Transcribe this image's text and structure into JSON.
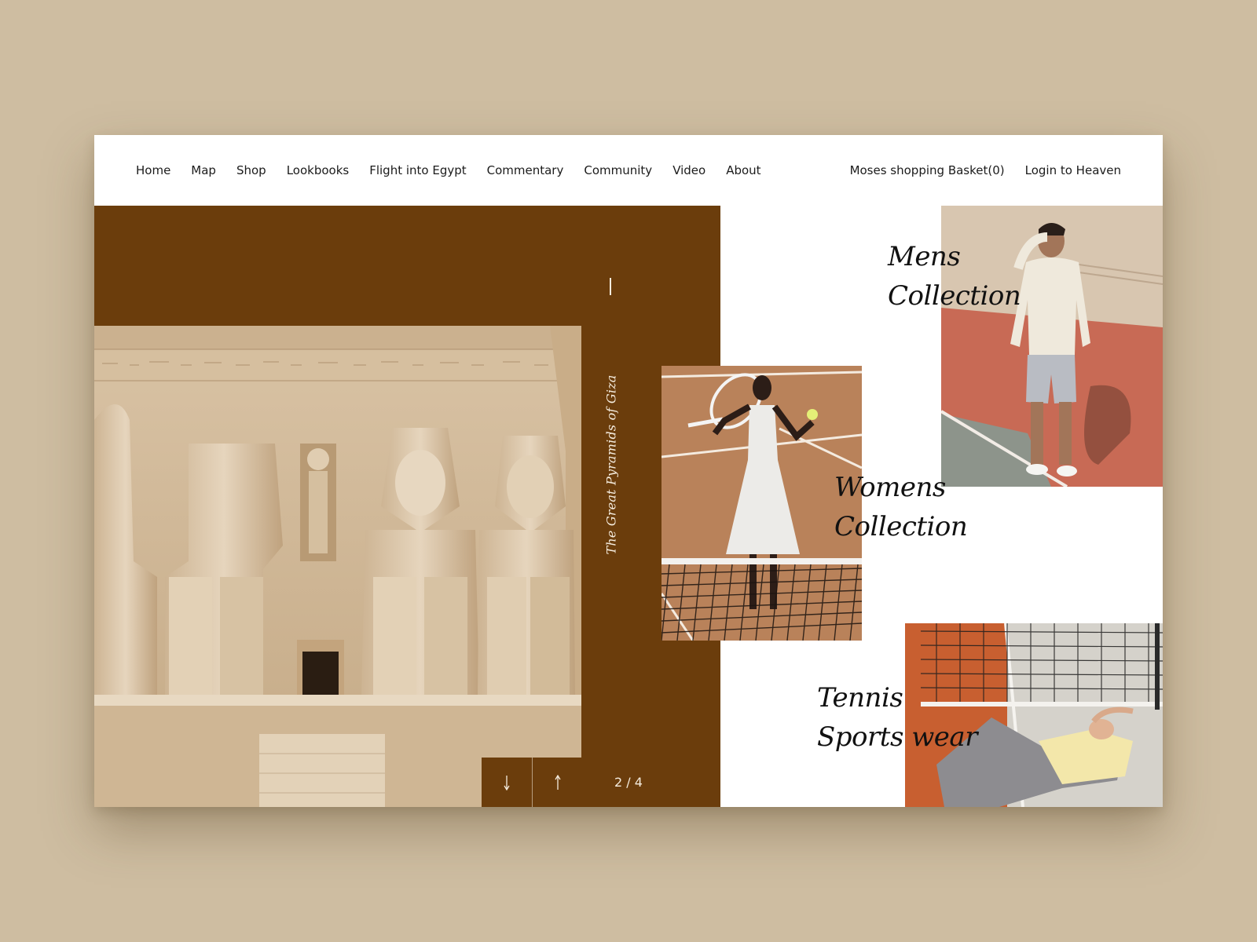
{
  "nav": {
    "left": [
      {
        "label": "Home"
      },
      {
        "label": "Map"
      },
      {
        "label": "Shop"
      },
      {
        "label": "Lookbooks"
      },
      {
        "label": "Flight into Egypt"
      },
      {
        "label": "Commentary"
      },
      {
        "label": "Community"
      },
      {
        "label": "Video"
      },
      {
        "label": "About"
      }
    ],
    "basket": "Moses shopping Basket(0)",
    "login": "Login to Heaven"
  },
  "hero": {
    "caption": "The Great Pyramids of Giza",
    "pager": {
      "down_icon": "arrow-down-icon",
      "up_icon": "arrow-up-icon",
      "count": "2 / 4"
    }
  },
  "collections": {
    "mens": {
      "line1": "Mens",
      "line2": "Collection"
    },
    "womens": {
      "line1": "Womens",
      "line2": "Collection"
    },
    "tennis": {
      "line1": "Tennis",
      "line2": "Sports wear"
    }
  },
  "colors": {
    "background": "#cebda1",
    "hero_brown": "#6b3d0c",
    "text": "#111111"
  }
}
